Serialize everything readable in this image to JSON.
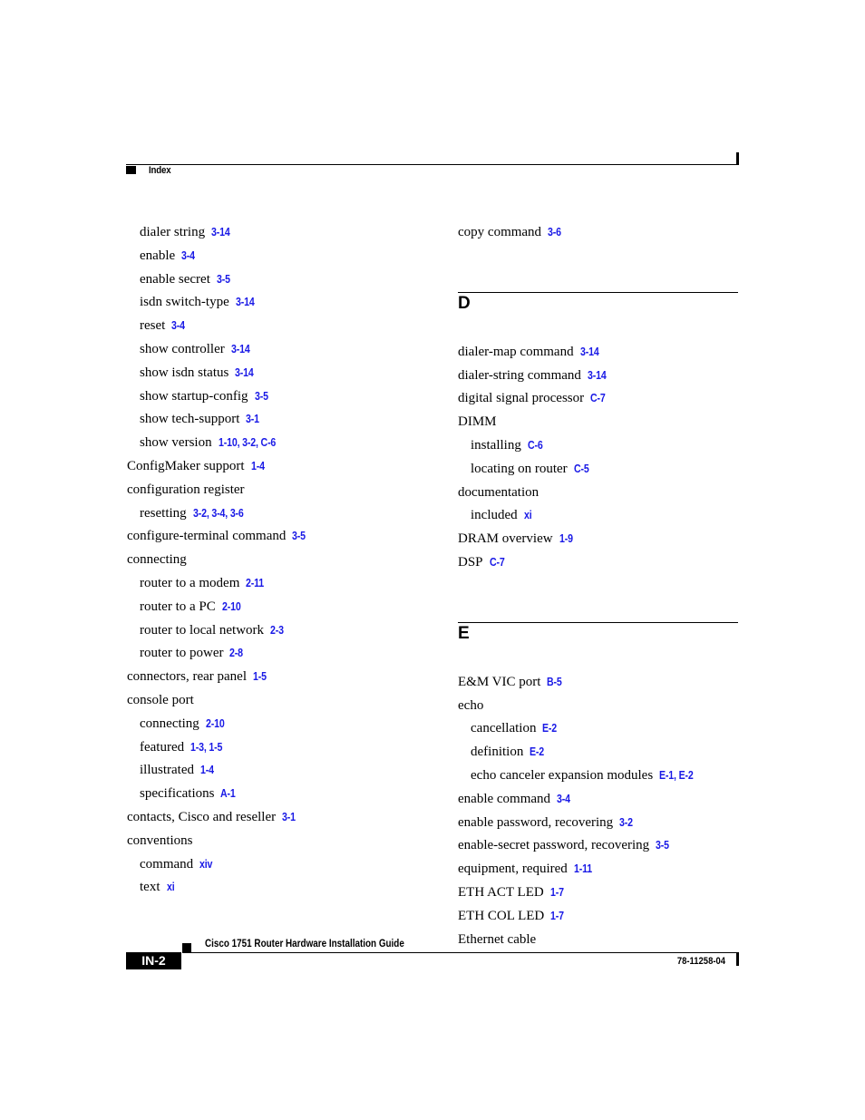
{
  "header": {
    "section_title": "Index"
  },
  "left_column": [
    {
      "text": "dialer string",
      "refs": "3-14",
      "level": 1
    },
    {
      "text": "enable",
      "refs": "3-4",
      "level": 1
    },
    {
      "text": "enable secret",
      "refs": "3-5",
      "level": 1
    },
    {
      "text": "isdn switch-type",
      "refs": "3-14",
      "level": 1
    },
    {
      "text": "reset",
      "refs": "3-4",
      "level": 1
    },
    {
      "text": "show controller",
      "refs": "3-14",
      "level": 1
    },
    {
      "text": "show isdn status",
      "refs": "3-14",
      "level": 1
    },
    {
      "text": "show startup-config",
      "refs": "3-5",
      "level": 1
    },
    {
      "text": "show tech-support",
      "refs": "3-1",
      "level": 1
    },
    {
      "text": "show version",
      "refs": "1-10, 3-2, C-6",
      "level": 1
    },
    {
      "text": "ConfigMaker support",
      "refs": "1-4",
      "level": 0
    },
    {
      "text": "configuration register",
      "refs": "",
      "level": 0
    },
    {
      "text": "resetting",
      "refs": "3-2, 3-4, 3-6",
      "level": 1
    },
    {
      "text": "configure-terminal command",
      "refs": "3-5",
      "level": 0
    },
    {
      "text": "connecting",
      "refs": "",
      "level": 0
    },
    {
      "text": "router to a modem",
      "refs": "2-11",
      "level": 1
    },
    {
      "text": "router to a PC",
      "refs": "2-10",
      "level": 1
    },
    {
      "text": "router to local network",
      "refs": "2-3",
      "level": 1
    },
    {
      "text": "router to power",
      "refs": "2-8",
      "level": 1
    },
    {
      "text": "connectors, rear panel",
      "refs": "1-5",
      "level": 0
    },
    {
      "text": "console port",
      "refs": "",
      "level": 0
    },
    {
      "text": "connecting",
      "refs": "2-10",
      "level": 1
    },
    {
      "text": "featured",
      "refs": "1-3, 1-5",
      "level": 1
    },
    {
      "text": "illustrated",
      "refs": "1-4",
      "level": 1
    },
    {
      "text": "specifications",
      "refs": "A-1",
      "level": 1
    },
    {
      "text": "contacts, Cisco and reseller",
      "refs": "3-1",
      "level": 0
    },
    {
      "text": "conventions",
      "refs": "",
      "level": 0
    },
    {
      "text": "command",
      "refs": "xiv",
      "level": 1
    },
    {
      "text": "text",
      "refs": "xi",
      "level": 1
    }
  ],
  "right_column": {
    "lead_entries": [
      {
        "text": "copy command",
        "refs": "3-6",
        "level": 0
      }
    ],
    "sections": [
      {
        "letter": "D",
        "entries": [
          {
            "text": "dialer-map command",
            "refs": "3-14",
            "level": 0
          },
          {
            "text": "dialer-string command",
            "refs": "3-14",
            "level": 0
          },
          {
            "text": "digital signal processor",
            "refs": "C-7",
            "level": 0
          },
          {
            "text": "DIMM",
            "refs": "",
            "level": 0
          },
          {
            "text": "installing",
            "refs": "C-6",
            "level": 1
          },
          {
            "text": "locating on router",
            "refs": "C-5",
            "level": 1
          },
          {
            "text": "documentation",
            "refs": "",
            "level": 0
          },
          {
            "text": "included",
            "refs": "xi",
            "level": 1
          },
          {
            "text": "DRAM overview",
            "refs": "1-9",
            "level": 0
          },
          {
            "text": "DSP",
            "refs": "C-7",
            "level": 0
          }
        ]
      },
      {
        "letter": "E",
        "entries": [
          {
            "text": "E&M VIC port",
            "refs": "B-5",
            "level": 0
          },
          {
            "text": "echo",
            "refs": "",
            "level": 0
          },
          {
            "text": "cancellation",
            "refs": "E-2",
            "level": 1
          },
          {
            "text": "definition",
            "refs": "E-2",
            "level": 1
          },
          {
            "text": "echo canceler expansion modules",
            "refs": "E-1, E-2",
            "level": 1
          },
          {
            "text": "enable command",
            "refs": "3-4",
            "level": 0
          },
          {
            "text": "enable password, recovering",
            "refs": "3-2",
            "level": 0
          },
          {
            "text": "enable-secret password, recovering",
            "refs": "3-5",
            "level": 0
          },
          {
            "text": "equipment, required",
            "refs": "1-11",
            "level": 0
          },
          {
            "text": "ETH ACT LED",
            "refs": "1-7",
            "level": 0
          },
          {
            "text": "ETH COL LED",
            "refs": "1-7",
            "level": 0
          },
          {
            "text": "Ethernet cable",
            "refs": "",
            "level": 0
          }
        ]
      }
    ]
  },
  "footer": {
    "book_title": "Cisco 1751 Router Hardware Installation Guide",
    "page_number": "IN-2",
    "doc_number": "78-11258-04"
  },
  "colors": {
    "link": "#1a1ae6",
    "text": "#000000"
  }
}
